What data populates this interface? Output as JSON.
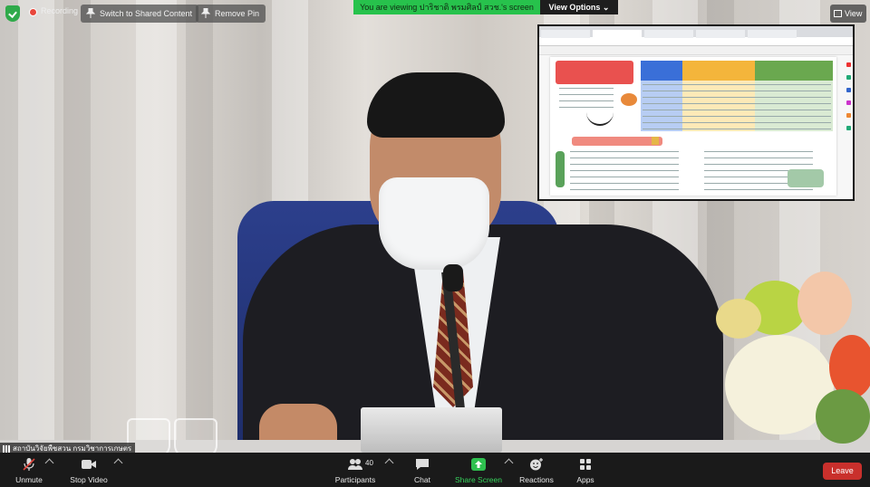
{
  "topbar": {
    "recording_label": "Recording",
    "switch_label": "Switch to Shared Content",
    "remove_pin_label": "Remove Pin",
    "viewing_label": "You are viewing ปาริชาติ พรมศิลป์ สวช.'s screen",
    "view_options_label": "View Options",
    "view_label": "View"
  },
  "participant": {
    "name": "สถาบันวิจัยพืชสวน กรมวิชาการเกษตร"
  },
  "toolbar": {
    "unmute": "Unmute",
    "stop_video": "Stop Video",
    "participants": "Participants",
    "participants_count": "40",
    "chat": "Chat",
    "share_screen": "Share Screen",
    "reactions": "Reactions",
    "apps": "Apps",
    "leave": "Leave"
  },
  "colors": {
    "share_green": "#27c24c",
    "leave_red": "#c9302c",
    "toolbar_bg": "#1a1a1a",
    "recording_red": "#e8463b"
  },
  "icons": [
    "shield-icon",
    "recording-icon",
    "pin-icon",
    "view-grid-icon",
    "microphone-muted-icon",
    "camera-icon",
    "participants-icon",
    "chat-icon",
    "share-screen-icon",
    "reactions-icon",
    "apps-icon",
    "caret-up-icon"
  ]
}
